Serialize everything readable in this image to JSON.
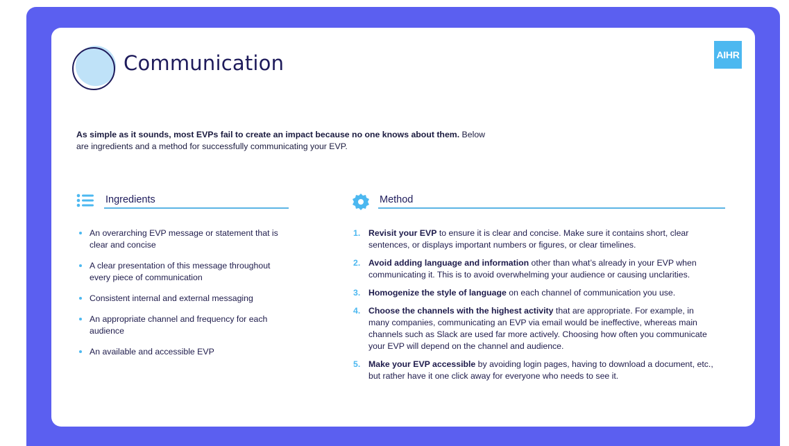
{
  "slide": {
    "title": "Communication",
    "logo_text": "AIHR",
    "title_icon": "circle-icon",
    "colors": {
      "frame": "#5b5ff0",
      "accent": "#4cb8f0",
      "text": "#1e1b4b"
    }
  },
  "intro": {
    "bold": "As simple as it sounds, most EVPs fail to create an impact because no one knows about them.",
    "rest": " Below are ingredients and a method for successfully communicating your EVP."
  },
  "ingredients": {
    "heading": "Ingredients",
    "icon": "list-icon",
    "items": [
      "An overarching EVP message or statement that is clear and concise",
      "A clear presentation of this message throughout every piece of communication",
      "Consistent internal and external messaging",
      "An appropriate channel and frequency for each audience",
      "An available and accessible EVP"
    ]
  },
  "method": {
    "heading": "Method",
    "icon": "gear-icon",
    "steps": [
      {
        "num": "1.",
        "bold": "Revisit your EVP",
        "rest": " to ensure it is clear and concise. Make sure it contains short, clear sentences, or displays important numbers or figures, or clear timelines."
      },
      {
        "num": "2.",
        "bold": "Avoid adding language and information",
        "rest": " other than what’s already in your EVP when communicating it. This is to avoid overwhelming your audience or causing unclarities."
      },
      {
        "num": "3.",
        "bold": "Homogenize the style of language",
        "rest": " on each channel of communication you use."
      },
      {
        "num": "4.",
        "bold": "Choose the channels with the highest activity",
        "rest": " that are appropriate. For example, in many companies, communicating an EVP via email would be ineffective, whereas main channels such as Slack are used far more actively. Choosing how often you communicate your EVP will depend on the channel and audience."
      },
      {
        "num": "5.",
        "bold": "Make your EVP accessible",
        "rest": " by avoiding login pages, having to download a document, etc., but rather have it one click away for everyone who needs to see it."
      }
    ]
  }
}
